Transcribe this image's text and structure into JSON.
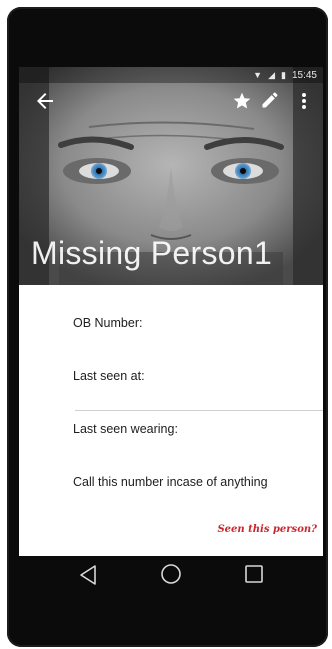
{
  "status_bar": {
    "time": "15:45"
  },
  "app_bar": {
    "back_icon": "arrow-back-icon",
    "actions": [
      "star-icon",
      "edit-pencil-icon",
      "more-vert-icon"
    ]
  },
  "header": {
    "title": "Missing Person1"
  },
  "fields": [
    {
      "label": "OB Number:"
    },
    {
      "label": "Last seen at:"
    },
    {
      "label": "Last seen wearing:"
    },
    {
      "label": "Call this number incase of anything"
    }
  ],
  "cta": {
    "label": "Seen this person?",
    "color": "#c8262c"
  },
  "nav_bar": {
    "icons": [
      "nav-back-icon",
      "nav-home-icon",
      "nav-recents-icon"
    ]
  }
}
